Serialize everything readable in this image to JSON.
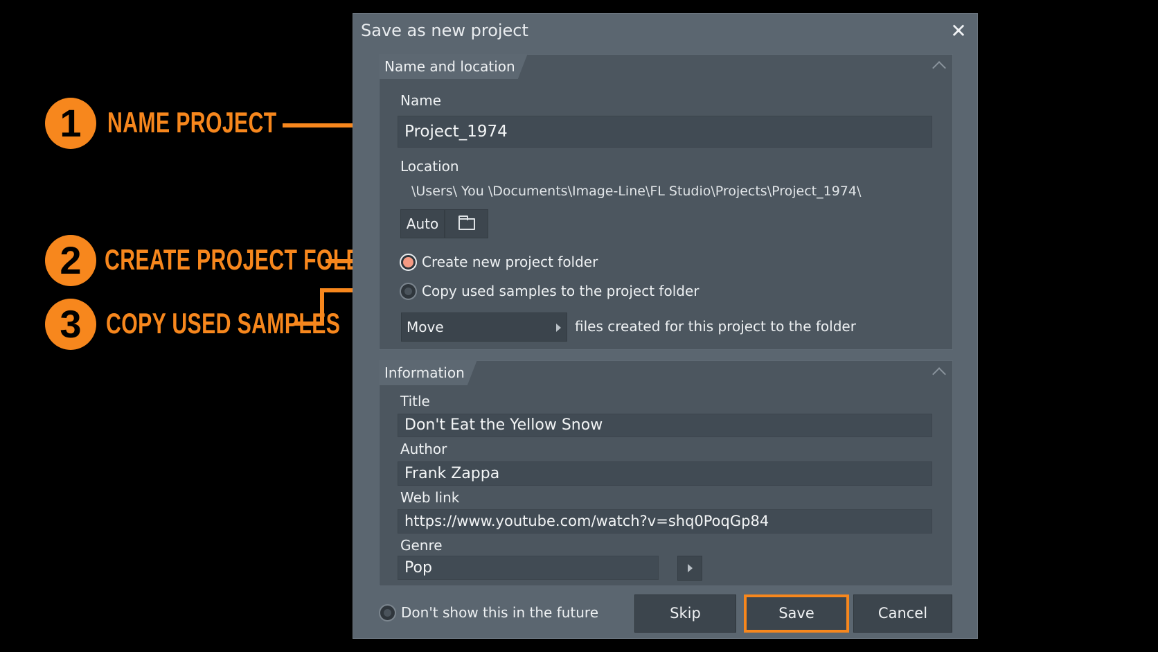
{
  "dialog": {
    "title": "Save as new project"
  },
  "name_location": {
    "header": "Name and location",
    "name_label": "Name",
    "name_value": "Project_1974",
    "location_label": "Location",
    "location_path": "\\Users\\ You \\Documents\\Image-Line\\FL Studio\\Projects\\Project_1974\\",
    "auto_button": "Auto",
    "create_folder_label": "Create new project folder",
    "copy_samples_label": "Copy used samples to the project folder",
    "move_dropdown": "Move",
    "move_suffix": "files created for this project to the folder"
  },
  "information": {
    "header": "Information",
    "title_label": "Title",
    "title_value": "Don't Eat the Yellow Snow",
    "author_label": "Author",
    "author_value": "Frank Zappa",
    "weblink_label": "Web link",
    "weblink_value": "https://www.youtube.com/watch?v=shq0PoqGp84",
    "genre_label": "Genre",
    "genre_value": "Pop"
  },
  "footer": {
    "dont_show_label": "Don't show this in the future",
    "skip_button": "Skip",
    "save_button": "Save",
    "cancel_button": "Cancel"
  },
  "annotations": [
    {
      "number": "1",
      "label": "NAME PROJECT"
    },
    {
      "number": "2",
      "label": "CREATE PROJECT FOLDER"
    },
    {
      "number": "3",
      "label": "COPY USED SAMPLES"
    }
  ],
  "colors": {
    "accent_orange": "#f7871d",
    "dialog_bg": "#5b6670",
    "section_bg": "#4c565f",
    "field_bg": "#414b54",
    "radio_on": "#f59a83"
  }
}
